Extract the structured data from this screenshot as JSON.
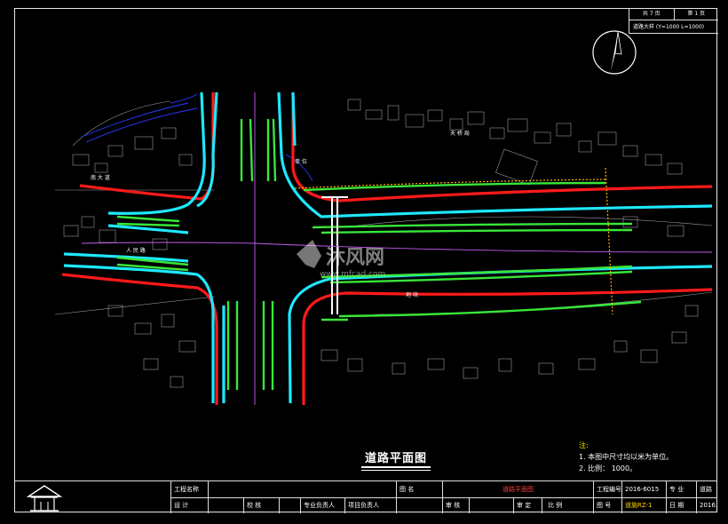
{
  "sheet": {
    "page_label": "共 7 页",
    "sheet_label": "第 1 页",
    "scale_label": "道路大样 (Y≈1000 L≈1000)"
  },
  "drawing": {
    "title": "道路平面图",
    "labels": [
      "南 大 道",
      "单 位",
      "天 桥 局",
      "地 块",
      "人 民 路"
    ],
    "watermark_brand": "沐风网",
    "watermark_url": "www.mfcad.com"
  },
  "notes": {
    "head": "注:",
    "line1": "1. 本图中尺寸均以米为单位。",
    "line2": "2. 比例： 1000。"
  },
  "title_block": {
    "project_name_label": "工程名称",
    "drawing_name_label": "图 名",
    "drawing_name_value": "道路平面图",
    "project_no_label": "工程编号",
    "project_no_value": "2016-6015",
    "discipline_label": "专 业",
    "discipline_value": "道路",
    "design_label": "设 计",
    "check_label": "校 核",
    "specialty_lead_label": "专业负责人",
    "project_lead_label": "项目负责人",
    "review_label": "审 核",
    "approve_label": "审 定",
    "scale_label": "比 例",
    "drawing_no_label": "图 号",
    "drawing_no_value": "道施RZ-1",
    "date_label": "日 期",
    "date_value": "2016. 6"
  },
  "colors": {
    "road_edge": "#ff1a1a",
    "kerb": "#1ee8ff",
    "median": "#39e639",
    "bg": "#000000"
  }
}
